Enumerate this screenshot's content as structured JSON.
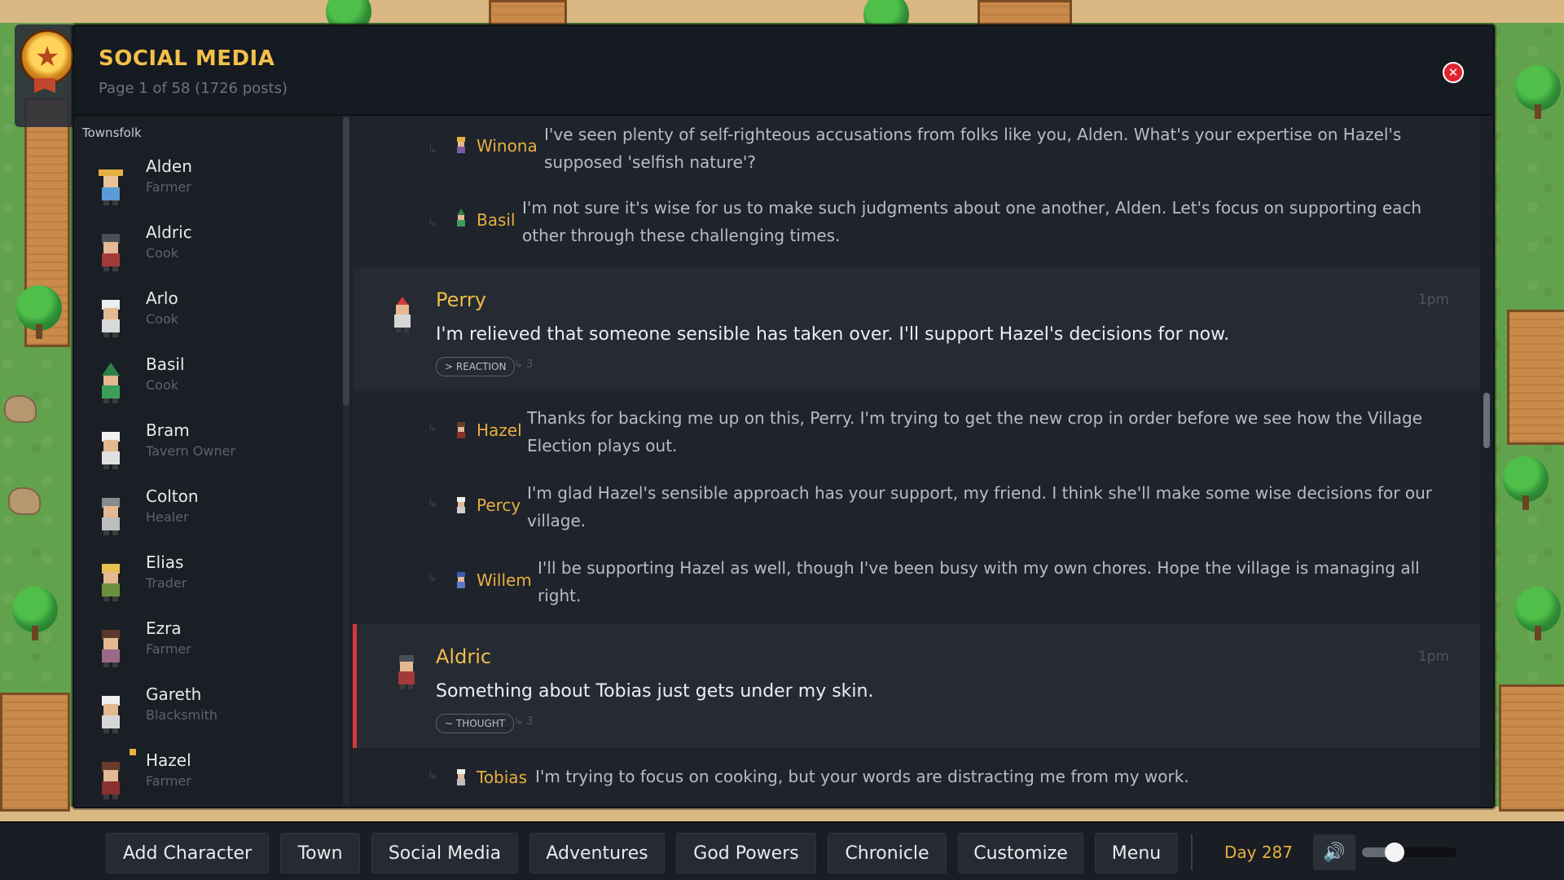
{
  "header": {
    "title": "SOCIAL MEDIA",
    "subtitle": "Page 1 of 58 (1726 posts)",
    "close_icon": "close-icon",
    "badge_icon": "star-badge-icon"
  },
  "sidebar": {
    "title": "Townsfolk",
    "characters": [
      {
        "name": "Alden",
        "role": "Farmer"
      },
      {
        "name": "Aldric",
        "role": "Cook"
      },
      {
        "name": "Arlo",
        "role": "Cook"
      },
      {
        "name": "Basil",
        "role": "Cook"
      },
      {
        "name": "Bram",
        "role": "Tavern Owner"
      },
      {
        "name": "Colton",
        "role": "Healer"
      },
      {
        "name": "Elias",
        "role": "Trader"
      },
      {
        "name": "Ezra",
        "role": "Farmer"
      },
      {
        "name": "Gareth",
        "role": "Blacksmith"
      },
      {
        "name": "Hazel",
        "role": "Farmer"
      }
    ]
  },
  "feed": {
    "replies_top": [
      {
        "name": "Winona",
        "text_1": "I've seen plenty of self-righteous accusations from folks like you, Alden. What's your expertise on Hazel's",
        "text_2": "supposed 'selfish nature'?"
      },
      {
        "name": "Basil",
        "text_1": "I'm not sure it's wise for us to make such judgments about one another, Alden. Let's focus on supporting each",
        "text_2": "other through these challenging times."
      }
    ],
    "post_1": {
      "author": "Perry",
      "text": "I'm relieved that someone sensible has taken over. I'll support Hazel's decisions for now.",
      "time": "1pm",
      "tag": "> REACTION",
      "reply_count": "↳ 3"
    },
    "replies_1": [
      {
        "name": "Hazel",
        "text_1": "Thanks for backing me up on this, Perry. I'm trying to get the new crop in order before we see how the Village",
        "text_2": "Election plays out."
      },
      {
        "name": "Percy",
        "text_1": "I'm glad Hazel's sensible approach has your support, my friend. I think she'll make some wise decisions for our",
        "text_2": "village."
      },
      {
        "name": "Willem",
        "text_1": "I'll be supporting Hazel as well, though I've been busy with my own chores. Hope the village is managing all",
        "text_2": "right."
      }
    ],
    "post_2": {
      "author": "Aldric",
      "text": "Something about Tobias just gets under my skin.",
      "time": "1pm",
      "tag": "~ THOUGHT",
      "reply_count": "↳ 3"
    },
    "replies_2": [
      {
        "name": "Tobias",
        "text_1": "I'm trying to focus on cooking, but your words are distracting me from my work.",
        "text_2": ""
      }
    ],
    "reply_connector": "↳"
  },
  "toolbar": {
    "buttons": [
      "Add Character",
      "Town",
      "Social Media",
      "Adventures",
      "God Powers",
      "Chronicle",
      "Customize",
      "Menu"
    ],
    "day": "Day 287",
    "volume_icon": "speaker-icon",
    "volume_level": 0.3
  },
  "colors": {
    "accent_gold": "#f0bd47",
    "thought_accent": "#d23a3a",
    "close_red": "#e0242e"
  }
}
